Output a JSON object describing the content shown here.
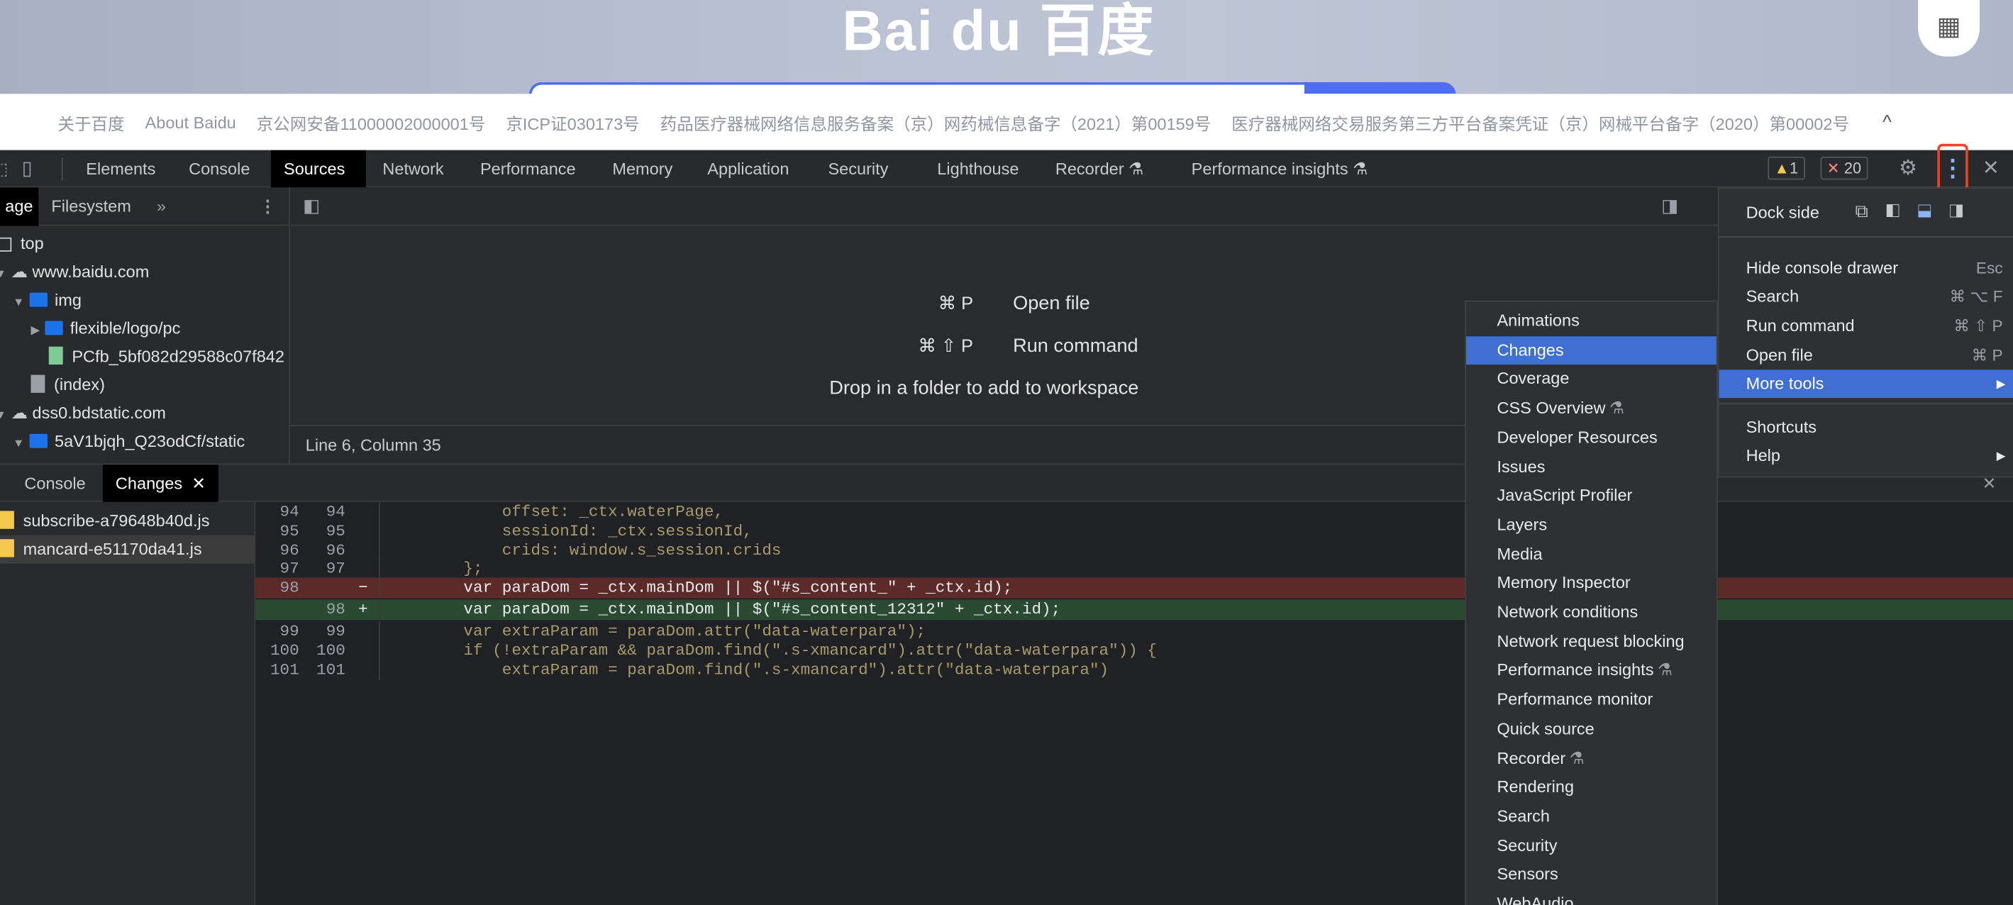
{
  "header": {
    "logo": "Bai du 百度",
    "qr_label": "QR"
  },
  "footer": {
    "links": [
      "关于百度",
      "About Baidu",
      "京公网安备11000002000001号",
      "京ICP证030173号",
      "药品医疗器械网络信息服务备案（京）网药械信息备字（2021）第00159号",
      "医疗器械网络交易服务第三方平台备案凭证（京）网械平台备字（2020）第00002号"
    ],
    "collapse_icon": "^"
  },
  "devtools": {
    "tabs": [
      "Elements",
      "Console",
      "Sources",
      "Network",
      "Performance",
      "Memory",
      "Application",
      "Security",
      "Lighthouse",
      "Recorder",
      "Performance insights"
    ],
    "selected_tab": "Sources",
    "warnings": "1",
    "errors": "20",
    "nav_tabs": [
      "age",
      "Filesystem"
    ],
    "tree": [
      "top",
      "www.baidu.com",
      "img",
      "flexible/logo/pc",
      "PCfb_5bf082d29588c07f842",
      "(index)",
      "dss0.bdstatic.com",
      "5aV1bjqh_Q23odCf/static"
    ],
    "editor": {
      "shortcut1": "⌘ P",
      "label1": "Open file",
      "shortcut2": "⌘ ⇧ P",
      "label2": "Run command",
      "drop": "Drop in a folder to add to workspace",
      "status": "Line 6, Column 35"
    },
    "drawer_tabs": [
      "Console",
      "Changes"
    ],
    "changed_files": [
      "subscribe-a79648b40d.js",
      "mancard-e51170da41.js"
    ],
    "diff": [
      {
        "a": "94",
        "b": "94",
        "m": "",
        "code": "            offset: _ctx.waterPage,",
        "t": "n"
      },
      {
        "a": "95",
        "b": "95",
        "m": "",
        "code": "            sessionId: _ctx.sessionId,",
        "t": "n"
      },
      {
        "a": "96",
        "b": "96",
        "m": "",
        "code": "            crids: window.s_session.crids",
        "t": "n"
      },
      {
        "a": "97",
        "b": "97",
        "m": "",
        "code": "        };",
        "t": "n"
      },
      {
        "a": "98",
        "b": "",
        "m": "−",
        "code": "        var paraDom = _ctx.mainDom || $(\"#s_content_\" + _ctx.id);",
        "t": "d"
      },
      {
        "a": "",
        "b": "98",
        "m": "+",
        "code": "        var paraDom = _ctx.mainDom || $(\"#s_content_12312\" + _ctx.id);",
        "t": "i"
      },
      {
        "a": "99",
        "b": "99",
        "m": "",
        "code": "        var extraParam = paraDom.attr(\"data-waterpara\");",
        "t": "n"
      },
      {
        "a": "100",
        "b": "100",
        "m": "",
        "code": "        if (!extraParam && paraDom.find(\".s-xmancard\").attr(\"data-waterpara\")) {",
        "t": "n"
      },
      {
        "a": "101",
        "b": "101",
        "m": "",
        "code": "            extraParam = paraDom.find(\".s-xmancard\").attr(\"data-waterpara\")",
        "t": "n"
      }
    ]
  },
  "main_menu": {
    "dock_label": "Dock side",
    "items": [
      {
        "label": "Hide console drawer",
        "kbd": "Esc"
      },
      {
        "label": "Search",
        "kbd": "⌘ ⌥ F"
      },
      {
        "label": "Run command",
        "kbd": "⌘ ⇧ P"
      },
      {
        "label": "Open file",
        "kbd": "⌘ P"
      },
      {
        "label": "More tools",
        "kbd": "▶"
      },
      {
        "label": "Shortcuts",
        "kbd": ""
      },
      {
        "label": "Help",
        "kbd": "▶"
      }
    ]
  },
  "more_tools": [
    "Animations",
    "Changes",
    "Coverage",
    "CSS Overview",
    "Developer Resources",
    "Issues",
    "JavaScript Profiler",
    "Layers",
    "Media",
    "Memory Inspector",
    "Network conditions",
    "Network request blocking",
    "Performance insights",
    "Performance monitor",
    "Quick source",
    "Recorder",
    "Rendering",
    "Search",
    "Security",
    "Sensors",
    "WebAudio"
  ],
  "experimental_mark": "⚗",
  "colors": {
    "accent": "#3f6fd1",
    "highlight_box": "#e8452c",
    "deleted_bg": "#5c2b29",
    "inserted_bg": "#2b4a32"
  }
}
